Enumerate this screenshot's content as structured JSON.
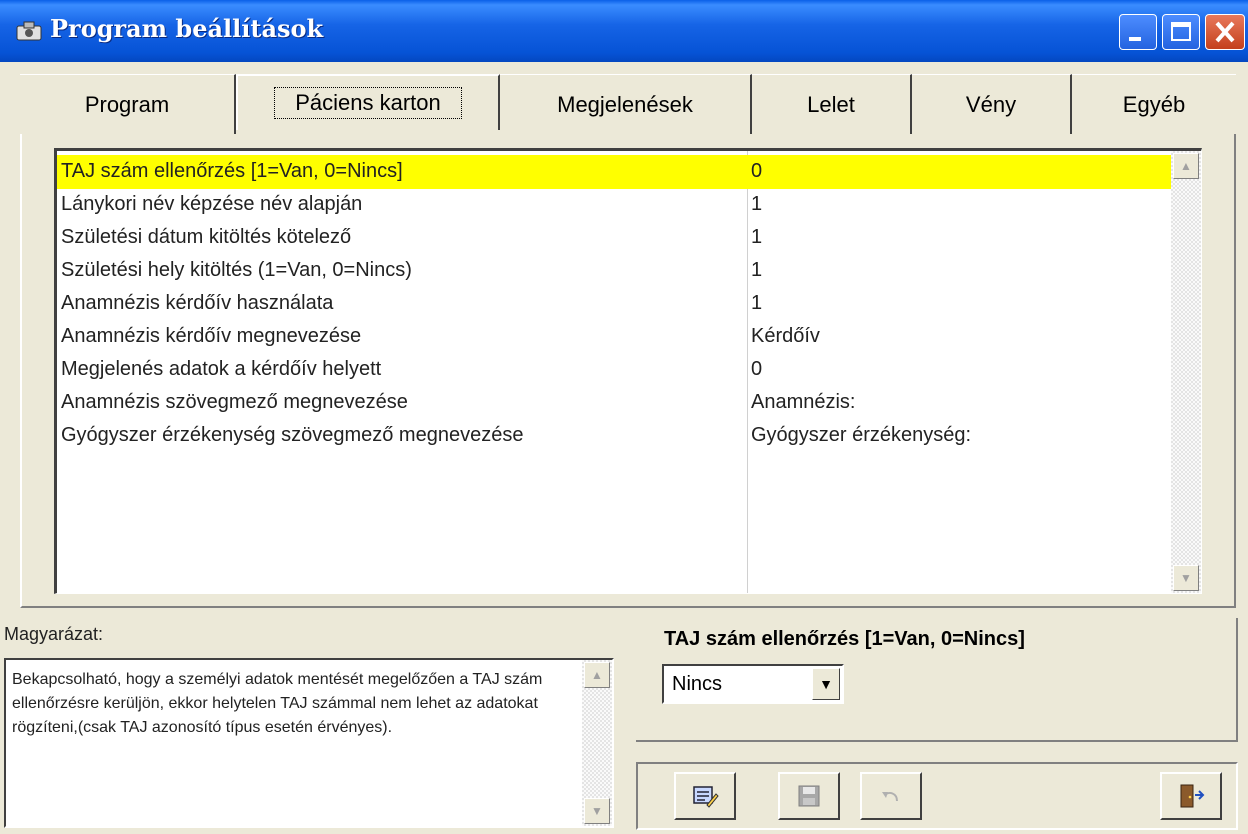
{
  "window": {
    "title": "Program beállítások"
  },
  "tabs": [
    {
      "label": "Program"
    },
    {
      "label": "Páciens karton"
    },
    {
      "label": "Megjelenések"
    },
    {
      "label": "Lelet"
    },
    {
      "label": "Vény"
    },
    {
      "label": "Egyéb"
    }
  ],
  "settings": [
    {
      "key": "TAJ szám ellenőrzés [1=Van, 0=Nincs]",
      "value": "0"
    },
    {
      "key": "Lánykori név képzése név alapján",
      "value": "1"
    },
    {
      "key": "Születési dátum kitöltés kötelező",
      "value": "1"
    },
    {
      "key": "Születési hely kitöltés (1=Van, 0=Nincs)",
      "value": "1"
    },
    {
      "key": "Anamnézis kérdőív használata",
      "value": "1"
    },
    {
      "key": "Anamnézis kérdőív megnevezése",
      "value": "Kérdőív"
    },
    {
      "key": "Megjelenés adatok a kérdőív helyett",
      "value": "0"
    },
    {
      "key": "Anamnézis szövegmező megnevezése",
      "value": "Anamnézis:"
    },
    {
      "key": "Gyógyszer érzékenység szövegmező megnevezése",
      "value": "Gyógyszer érzékenység:"
    }
  ],
  "explanation": {
    "label": "Magyarázat:",
    "text": "Bekapcsolható, hogy a személyi adatok mentését megelőzően a TAJ szám ellenőrzésre kerüljön, ekkor helytelen TAJ számmal nem lehet az adatokat rögzíteni,(csak TAJ azonosító típus esetén érvényes)."
  },
  "property": {
    "title": "TAJ szám ellenőrzés [1=Van, 0=Nincs]",
    "selected": "Nincs"
  },
  "colors": {
    "selection": "#ffff00",
    "titlebar": "#0653d6"
  }
}
